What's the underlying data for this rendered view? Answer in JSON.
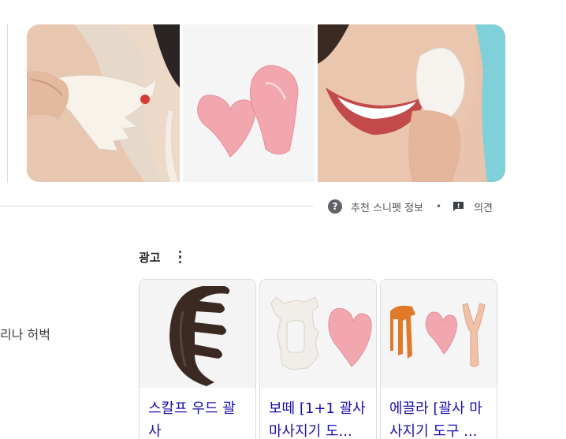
{
  "snippet_footer": {
    "help_glyph": "?",
    "about_label": "추천 스니펫 정보",
    "separator": "•",
    "feedback_label": "의견"
  },
  "ads": {
    "label": "광고",
    "cards": [
      {
        "title": "스칼프 우드 괄사"
      },
      {
        "title": "보떼 [1+1 괄사 마사지기 도..."
      },
      {
        "title": "에끌라 [괄사 마사지기 도구 ..."
      }
    ]
  },
  "left_fragment": "리나 허벅",
  "colors": {
    "link": "#1a0dab",
    "rose_quartz": "#f2a7ae",
    "divider": "#dadce0"
  }
}
